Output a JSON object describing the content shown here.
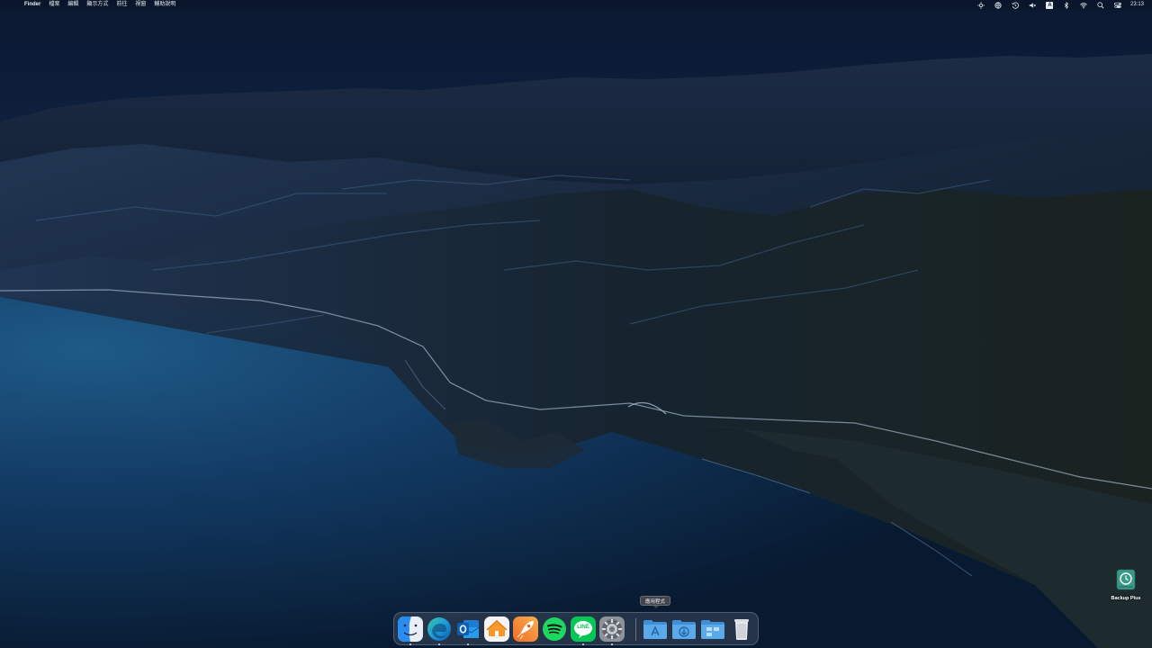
{
  "menubar": {
    "apple_glyph": "",
    "app_name": "Finder",
    "menus": [
      "檔案",
      "編輯",
      "顯示方式",
      "前往",
      "視窗",
      "輔助說明"
    ],
    "status_icons": [
      "tracking-icon",
      "vpn-icon",
      "time-machine-icon",
      "mute-icon",
      "input-source-icon",
      "bluetooth-icon",
      "wifi-icon",
      "spotlight-icon",
      "control-center-icon"
    ],
    "input_source_label": "A",
    "clock": "23:13"
  },
  "desktop": {
    "icon_label": "Backup Plus",
    "icon": "external-drive-time-machine-icon"
  },
  "dock": {
    "tooltip": "應用程式",
    "apps": [
      {
        "name": "Finder",
        "icon": "finder-icon",
        "running": true
      },
      {
        "name": "Microsoft Edge",
        "icon": "edge-icon",
        "running": true
      },
      {
        "name": "Microsoft Outlook",
        "icon": "outlook-icon",
        "running": true
      },
      {
        "name": "Home",
        "icon": "home-icon",
        "running": false
      },
      {
        "name": "Rocket",
        "icon": "rocket-icon",
        "running": false
      },
      {
        "name": "Spotify",
        "icon": "spotify-icon",
        "running": false
      },
      {
        "name": "LINE",
        "icon": "line-icon",
        "running": true
      },
      {
        "name": "System Preferences",
        "icon": "system-preferences-icon",
        "running": true
      }
    ],
    "stacks": [
      {
        "name": "應用程式",
        "icon": "applications-folder-icon"
      },
      {
        "name": "Downloads",
        "icon": "downloads-folder-icon"
      },
      {
        "name": "Folder",
        "icon": "folder-icon"
      },
      {
        "name": "Trash",
        "icon": "trash-icon"
      }
    ],
    "line_label": "LINE"
  },
  "colors": {
    "spotify": "#1ed760",
    "line": "#06c755",
    "folder": "#5aa9ea",
    "sky": "#10244a",
    "sea": "#0f2d4d"
  }
}
